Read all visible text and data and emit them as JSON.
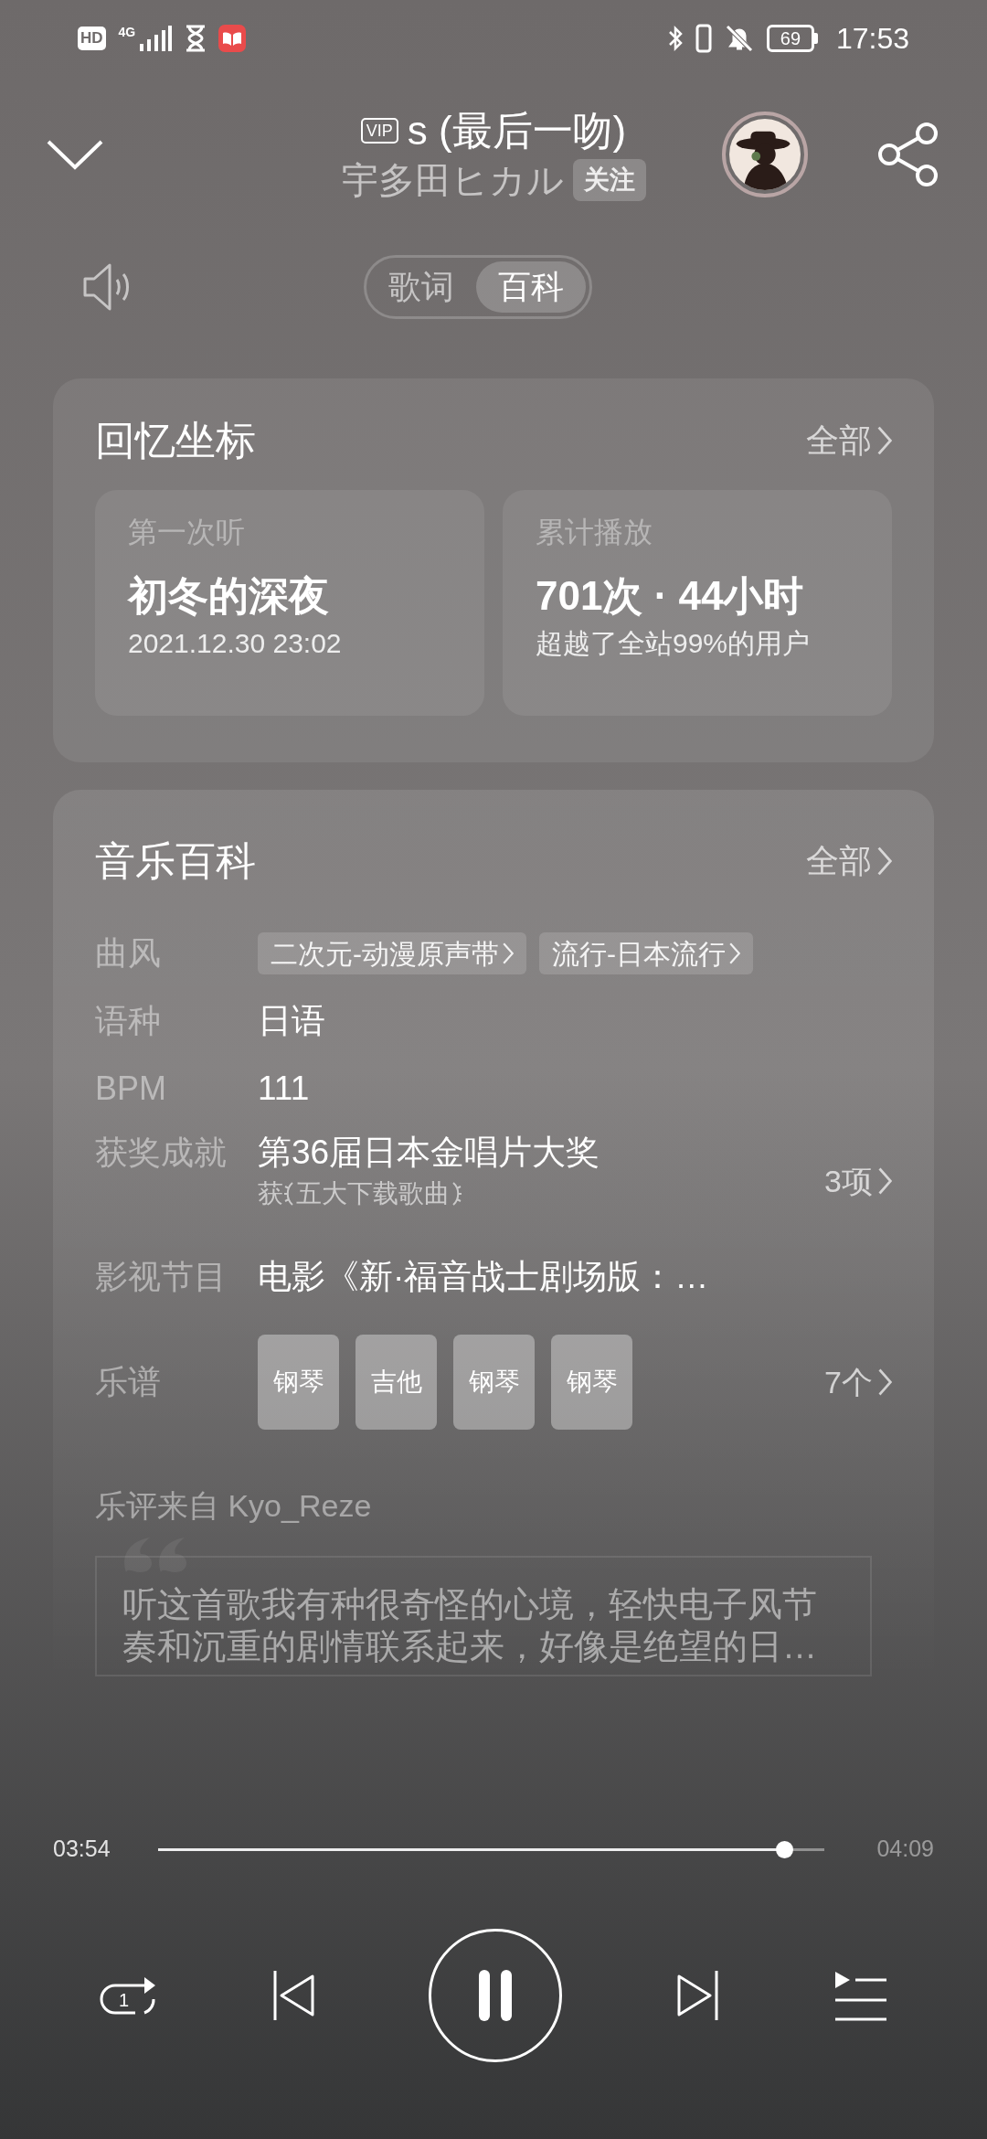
{
  "status_bar": {
    "hd": "HD",
    "network": "4G",
    "battery": "69",
    "time": "17:53"
  },
  "header": {
    "vip": "VIP",
    "title": "s (最后一吻)",
    "artist": "宇多田ヒカル",
    "follow": "关注"
  },
  "tabs": [
    {
      "label": "歌词",
      "selected": false
    },
    {
      "label": "百科",
      "selected": true
    }
  ],
  "memory": {
    "title": "回忆坐标",
    "more": "全部",
    "cards": [
      {
        "label": "第一次听",
        "value": "初冬的深夜",
        "note": "2021.12.30 23:02"
      },
      {
        "label": "累计播放",
        "value": "701次 · 44小时",
        "note": "超越了全站99%的用户"
      }
    ]
  },
  "wiki": {
    "title": "音乐百科",
    "more": "全部",
    "rows": [
      {
        "kind": "tags",
        "label": "曲风",
        "tags": [
          "二次元-动漫原声带",
          "流行-日本流行"
        ]
      },
      {
        "kind": "text",
        "label": "语种",
        "value": "日语"
      },
      {
        "kind": "text",
        "label": "BPM",
        "value": "111"
      },
      {
        "kind": "award",
        "label": "获奖成就",
        "value": "第36届日本金唱片大奖",
        "prefix": "获",
        "honor": "五大下载歌曲",
        "count": "3项"
      },
      {
        "kind": "text",
        "label": "影视节目",
        "value": "电影《新·福音战士剧场版：…"
      },
      {
        "kind": "sheets",
        "label": "乐谱",
        "sheets": [
          "钢琴",
          "吉他",
          "钢琴",
          "钢琴"
        ],
        "count": "7个"
      }
    ],
    "review": {
      "source": "乐评来自 Kyo_Reze",
      "text": "听这首歌我有种很奇怪的心境，轻快电子风节奏和沉重的剧情联系起来，好像是绝望的日…"
    }
  },
  "progress": {
    "elapsed": "03:54",
    "total": "04:09",
    "level": 0.94
  },
  "player": {
    "repeat": "1",
    "playing": true
  }
}
